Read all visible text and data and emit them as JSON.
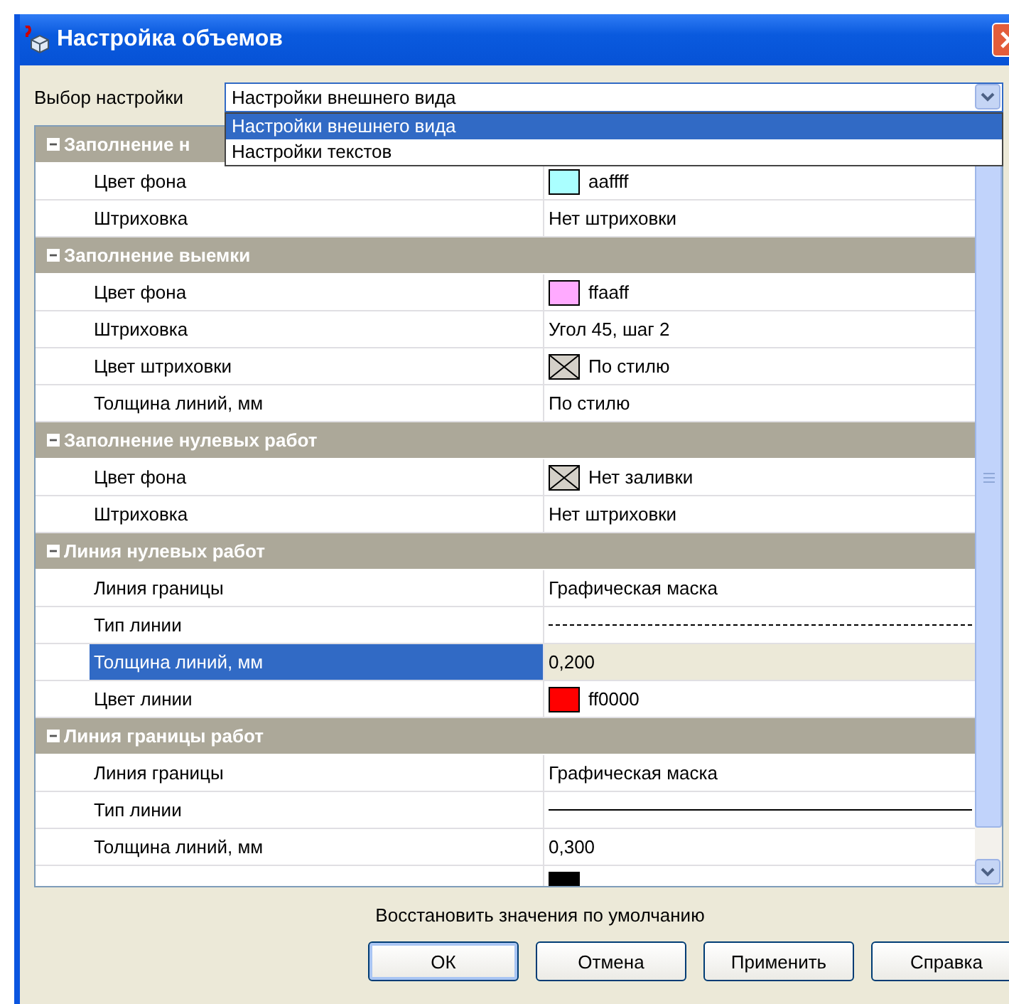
{
  "window": {
    "title": "Настройка объемов"
  },
  "setting": {
    "label": "Выбор настройки",
    "value": "Настройки внешнего вида",
    "expanded": true,
    "options": [
      {
        "label": "Настройки внешнего вида",
        "selected": true
      },
      {
        "label": "Настройки текстов",
        "selected": false
      }
    ]
  },
  "groups": [
    {
      "title": "Заполнение н",
      "expanded": true,
      "rows": [
        {
          "label": "Цвет фона",
          "kind": "color",
          "color": "#aaffff",
          "value": "aaffff",
          "selected": false
        },
        {
          "label": "Штриховка",
          "kind": "text",
          "value": "Нет штриховки",
          "selected": false
        }
      ]
    },
    {
      "title": "Заполнение выемки",
      "expanded": true,
      "rows": [
        {
          "label": "Цвет фона",
          "kind": "color",
          "color": "#ffaaff",
          "value": "ffaaff",
          "selected": false
        },
        {
          "label": "Штриховка",
          "kind": "text",
          "value": "Угол 45, шаг 2",
          "selected": false
        },
        {
          "label": "Цвет штриховки",
          "kind": "nocolor",
          "value": "По стилю",
          "selected": false
        },
        {
          "label": "Толщина линий, мм",
          "kind": "text",
          "value": "По стилю",
          "selected": false
        }
      ]
    },
    {
      "title": "Заполнение нулевых работ",
      "expanded": true,
      "rows": [
        {
          "label": "Цвет фона",
          "kind": "nocolor",
          "value": "Нет заливки",
          "selected": false
        },
        {
          "label": "Штриховка",
          "kind": "text",
          "value": "Нет штриховки",
          "selected": false
        }
      ]
    },
    {
      "title": "Линия нулевых работ",
      "expanded": true,
      "rows": [
        {
          "label": "Линия границы",
          "kind": "text",
          "value": "Графическая маска",
          "selected": false
        },
        {
          "label": "Тип линии",
          "kind": "dashed",
          "selected": false
        },
        {
          "label": "Толщина линий, мм",
          "kind": "text",
          "value": "0,200",
          "selected": true
        },
        {
          "label": "Цвет линии",
          "kind": "color",
          "color": "#ff0000",
          "value": "ff0000",
          "selected": false
        }
      ]
    },
    {
      "title": "Линия границы работ",
      "expanded": true,
      "rows": [
        {
          "label": "Линия границы",
          "kind": "text",
          "value": "Графическая маска",
          "selected": false
        },
        {
          "label": "Тип линии",
          "kind": "solid",
          "selected": false
        },
        {
          "label": "Толщина линий, мм",
          "kind": "text",
          "value": "0,300",
          "selected": false
        },
        {
          "kind": "color",
          "color": "#000000",
          "selected": false
        }
      ]
    }
  ],
  "restore": "Восстановить значения по умолчанию",
  "buttons": [
    {
      "label": "ОК",
      "default": true
    },
    {
      "label": "Отмена",
      "default": false
    },
    {
      "label": "Применить",
      "default": false
    },
    {
      "label": "Справка",
      "default": false
    }
  ]
}
